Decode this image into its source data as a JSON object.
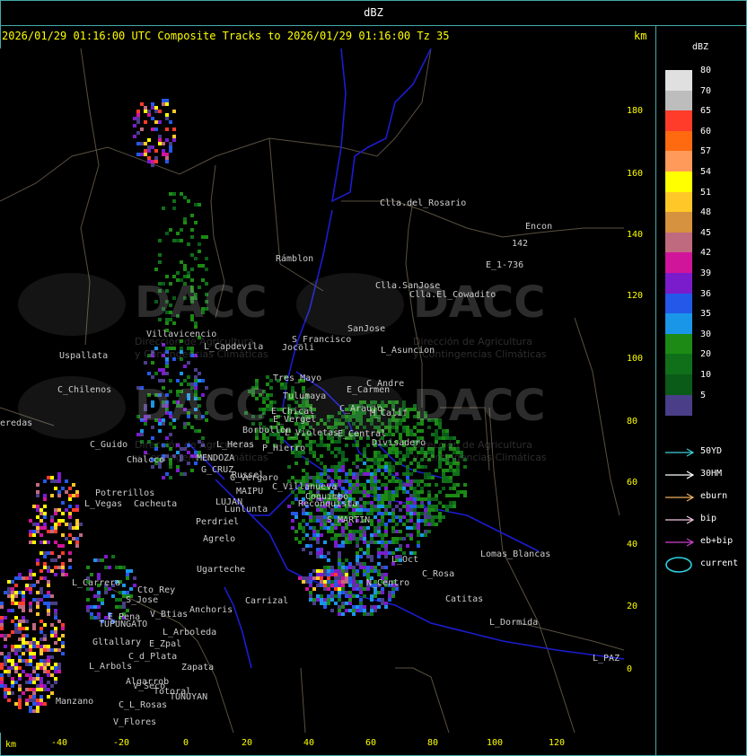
{
  "top_title": "dBZ",
  "header": "2026/01/29 01:16:00 UTC Composite Tracks to 2026/01/29 01:16:00 Tz 35",
  "km_label": "km",
  "y_ticks": [
    "180",
    "160",
    "140",
    "120",
    "100",
    "80",
    "60",
    "40",
    "20",
    "0"
  ],
  "x_ticks": [
    "-40",
    "-20",
    "0",
    "20",
    "40",
    "60",
    "80",
    "100",
    "120"
  ],
  "legend": {
    "unit": "dBZ",
    "scale": [
      {
        "label": "80",
        "color": "#e0e0e0"
      },
      {
        "label": "70",
        "color": "#bdbdbd"
      },
      {
        "label": "65",
        "color": "#ff3b2a"
      },
      {
        "label": "60",
        "color": "#ff6a10"
      },
      {
        "label": "57",
        "color": "#ff9a5a"
      },
      {
        "label": "54",
        "color": "#ffff00"
      },
      {
        "label": "51",
        "color": "#ffc828"
      },
      {
        "label": "48",
        "color": "#d6923e"
      },
      {
        "label": "45",
        "color": "#c06a80"
      },
      {
        "label": "42",
        "color": "#d0159a"
      },
      {
        "label": "39",
        "color": "#7a1ccc"
      },
      {
        "label": "36",
        "color": "#2458e8"
      },
      {
        "label": "35",
        "color": "#1a96e8"
      },
      {
        "label": "30",
        "color": "#1c8a14"
      },
      {
        "label": "20",
        "color": "#10701a"
      },
      {
        "label": "10",
        "color": "#0a5a18"
      },
      {
        "label": "5",
        "color": "#4a3e88"
      }
    ],
    "tracks": [
      {
        "label": "50YD",
        "color": "#40d0d8",
        "kind": "arrow"
      },
      {
        "label": "30HM",
        "color": "#ffffff",
        "kind": "arrow"
      },
      {
        "label": "eburn",
        "color": "#f0b060",
        "kind": "arrow"
      },
      {
        "label": "bip",
        "color": "#f0c8e0",
        "kind": "arrow"
      },
      {
        "label": "eb+bip",
        "color": "#d040d0",
        "kind": "arrow"
      },
      {
        "label": "current",
        "color": "#30d0e0",
        "kind": "ellipse"
      }
    ]
  },
  "watermark": {
    "name": "DACC",
    "line1": "Dirección de Agricultura",
    "line2": "y Contingencias Climáticas"
  },
  "places": [
    "Clla.del_Rosario",
    "Encon",
    "142",
    "E_1-736",
    "Rámblon",
    "Clla.SanJose",
    "Clla.El_Cowadito",
    "Villavicencio",
    "L_Capdevila",
    "S_Francisco",
    "SanJose",
    "L_Asuncion",
    "Uspallata",
    "Jocoli",
    "Tres_Mayo",
    "E_Carmen",
    "C_Andre",
    "Tulumaya",
    "C_Chilenos",
    "E_Chical",
    "C_Araujo",
    "M_Calif",
    "E_Vergel",
    "L_Violetas",
    "E_Central",
    "Divisadero",
    "Borbollon",
    "P_Hierro",
    "L_Heras",
    "MENDOZA",
    "G_CRUZ",
    "Chalcco",
    "C_Guido",
    "G_Vergaro",
    "C_Villanueva",
    "Reconquista",
    "Potrerillos",
    "Cacheuta",
    "L_Vegas",
    "Russel",
    "MAIPU",
    "LUJAN",
    "Perdriel",
    "Agrelo",
    "S_MARTIN",
    "Ugarteche",
    "L_Carrera",
    "Cto_Rey",
    "S_Jose",
    "Carrizal",
    "Anchoris",
    "E_Pena",
    "V_Btias",
    "TUPUNGATO",
    "L_Arboleda",
    "Gltallary",
    "E_Zpal",
    "C_d_Plata",
    "L_Arbols",
    "Zapata",
    "Algarrob",
    "V_Seco",
    "Manzano",
    "Totoral",
    "C_L_Rosas",
    "TUNUYAN",
    "V_Flores",
    "Lomas_Blancas",
    "Catitas",
    "L_Dormida",
    "L_PAZ",
    "Coquimbo",
    "Lunlunta",
    "eredas",
    "L_Oct",
    "N_Centro",
    "C_Rosa"
  ]
}
